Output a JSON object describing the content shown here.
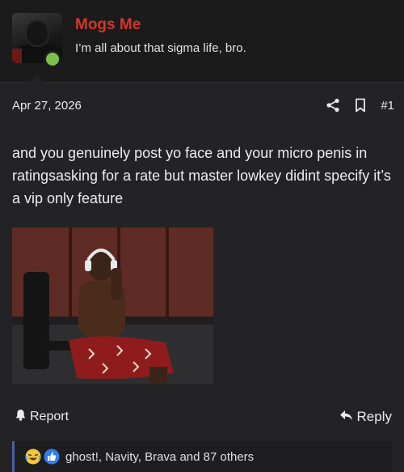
{
  "author": {
    "username": "Mogs Me",
    "title": "I’m all about that sigma life, bro.",
    "online": true
  },
  "post": {
    "date": "Apr 27, 2026",
    "number": "#1",
    "body": "and you genuinely post yo face and your micro penis in ratingsasking for a rate but master lowkey didint specify it’s a vip only feature"
  },
  "actions": {
    "report_label": "Report",
    "reply_label": "Reply"
  },
  "reactions": {
    "icons": [
      "laugh-cry-emoji-icon",
      "thumbs-up-icon"
    ],
    "summary": "ghost!, Navity, Brava and 87 others"
  },
  "icons": {
    "share": "share-icon",
    "bookmark": "bookmark-icon",
    "report": "bell-icon",
    "reply": "reply-arrow-icon"
  },
  "colors": {
    "username": "#d5342e",
    "online": "#7cc04b",
    "reaction_accent": "#4e5ea8"
  }
}
